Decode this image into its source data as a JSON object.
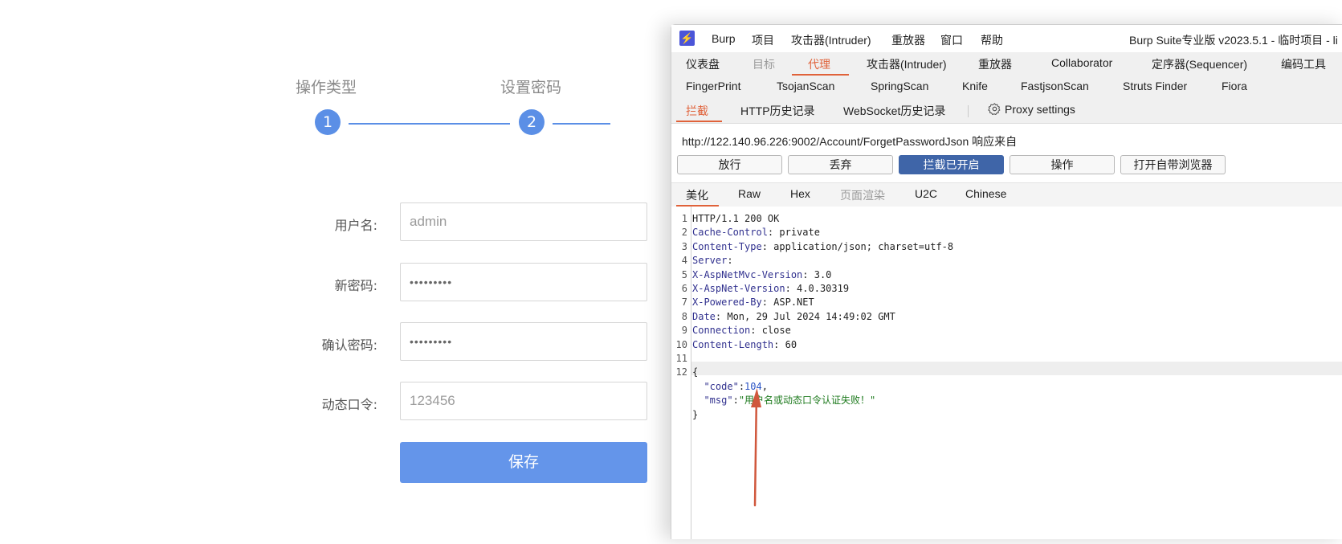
{
  "form": {
    "steps": [
      {
        "number": "1",
        "label": "操作类型"
      },
      {
        "number": "2",
        "label": "设置密码"
      }
    ],
    "fields": [
      {
        "label": "用户名:",
        "value": "admin"
      },
      {
        "label": "新密码:",
        "value": "•••••••••"
      },
      {
        "label": "确认密码:",
        "value": "•••••••••"
      },
      {
        "label": "动态口令:",
        "value": "123456"
      }
    ],
    "save_label": "保存"
  },
  "burp": {
    "menu": [
      "Burp",
      "项目",
      "攻击器(Intruder)",
      "重放器",
      "窗口",
      "帮助"
    ],
    "title": "Burp Suite专业版  v2023.5.1 - 临时项目 - li",
    "main_tabs": [
      "仪表盘",
      "目标",
      "代理",
      "攻击器(Intruder)",
      "重放器",
      "Collaborator",
      "定序器(Sequencer)",
      "编码工具"
    ],
    "ext_tabs": [
      "FingerPrint",
      "TsojanScan",
      "SpringScan",
      "Knife",
      "FastjsonScan",
      "Struts Finder",
      "Fiora"
    ],
    "proxy_tabs": [
      "拦截",
      "HTTP历史记录",
      "WebSocket历史记录"
    ],
    "proxy_settings": "Proxy settings",
    "url": "http://122.140.96.226:9002/Account/ForgetPasswordJson 响应来自",
    "buttons": [
      "放行",
      "丢弃",
      "拦截已开启",
      "操作",
      "打开自带浏览器"
    ],
    "view_tabs": [
      "美化",
      "Raw",
      "Hex",
      "页面渲染",
      "U2C",
      "Chinese"
    ],
    "lines": [
      {
        "n": "1",
        "key": "",
        "val": "HTTP/1.1 200 OK"
      },
      {
        "n": "2",
        "key": "Cache-Control",
        "val": ": private"
      },
      {
        "n": "3",
        "key": "Content-Type",
        "val": ": application/json; charset=utf-8"
      },
      {
        "n": "4",
        "key": "Server",
        "val": ":"
      },
      {
        "n": "5",
        "key": "X-AspNetMvc-Version",
        "val": ": 3.0"
      },
      {
        "n": "6",
        "key": "X-AspNet-Version",
        "val": ": 4.0.30319"
      },
      {
        "n": "7",
        "key": "X-Powered-By",
        "val": ": ASP.NET"
      },
      {
        "n": "8",
        "key": "Date",
        "val": ": Mon, 29 Jul 2024 14:49:02 GMT"
      },
      {
        "n": "9",
        "key": "Connection",
        "val": ": close"
      },
      {
        "n": "10",
        "key": "Content-Length",
        "val": ": 60"
      },
      {
        "n": "11",
        "key": "",
        "val": ""
      },
      {
        "n": "12",
        "key": "",
        "val": "{"
      }
    ],
    "json_body": {
      "code_key": "\"code\"",
      "code_val": "104",
      "msg_key": "\"msg\"",
      "msg_val": "\"用户名或动态口令认证失败！\"",
      "close": "}"
    }
  }
}
